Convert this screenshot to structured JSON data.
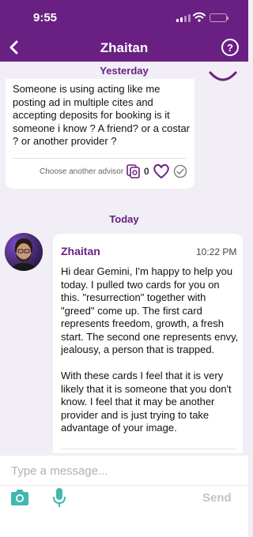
{
  "status_bar": {
    "time": "9:55"
  },
  "header": {
    "title": "Zhaitan",
    "help_label": "?"
  },
  "colors": {
    "brand": "#6a1f82",
    "background": "#f1eef6",
    "accent_teal": "#3fb8ae"
  },
  "conversation": {
    "yesterday_label": "Yesterday",
    "today_label": "Today",
    "question": {
      "text": "Someone is using acting like me posting ad in multiple cites and accepting deposits for booking is it someone i know ? A friend?  or a costar ? or another provider ?",
      "choose_advisor_label": "Choose another advisor",
      "copy_count": "0"
    },
    "answer": {
      "sender": "Zhaitan",
      "time": "10:22 PM",
      "body": "Hi dear Gemini, I'm happy to help you today. I pulled two cards for you on this. \"resurrection\" together with \"greed\" come up. The first card represents freedom, growth, a fresh start. The second one represents envy, jealousy, a person that is trapped.\n\nWith these cards I feel that it is very likely that it is someone that you don't know. I feel that it may be another provider and is just trying to take advantage of your image."
    }
  },
  "composer": {
    "placeholder": "Type a message...",
    "send_label": "Send"
  },
  "icons": [
    "back-arrow-icon",
    "help-icon",
    "copy-icon",
    "heart-icon",
    "check-icon",
    "camera-icon",
    "microphone-icon"
  ]
}
